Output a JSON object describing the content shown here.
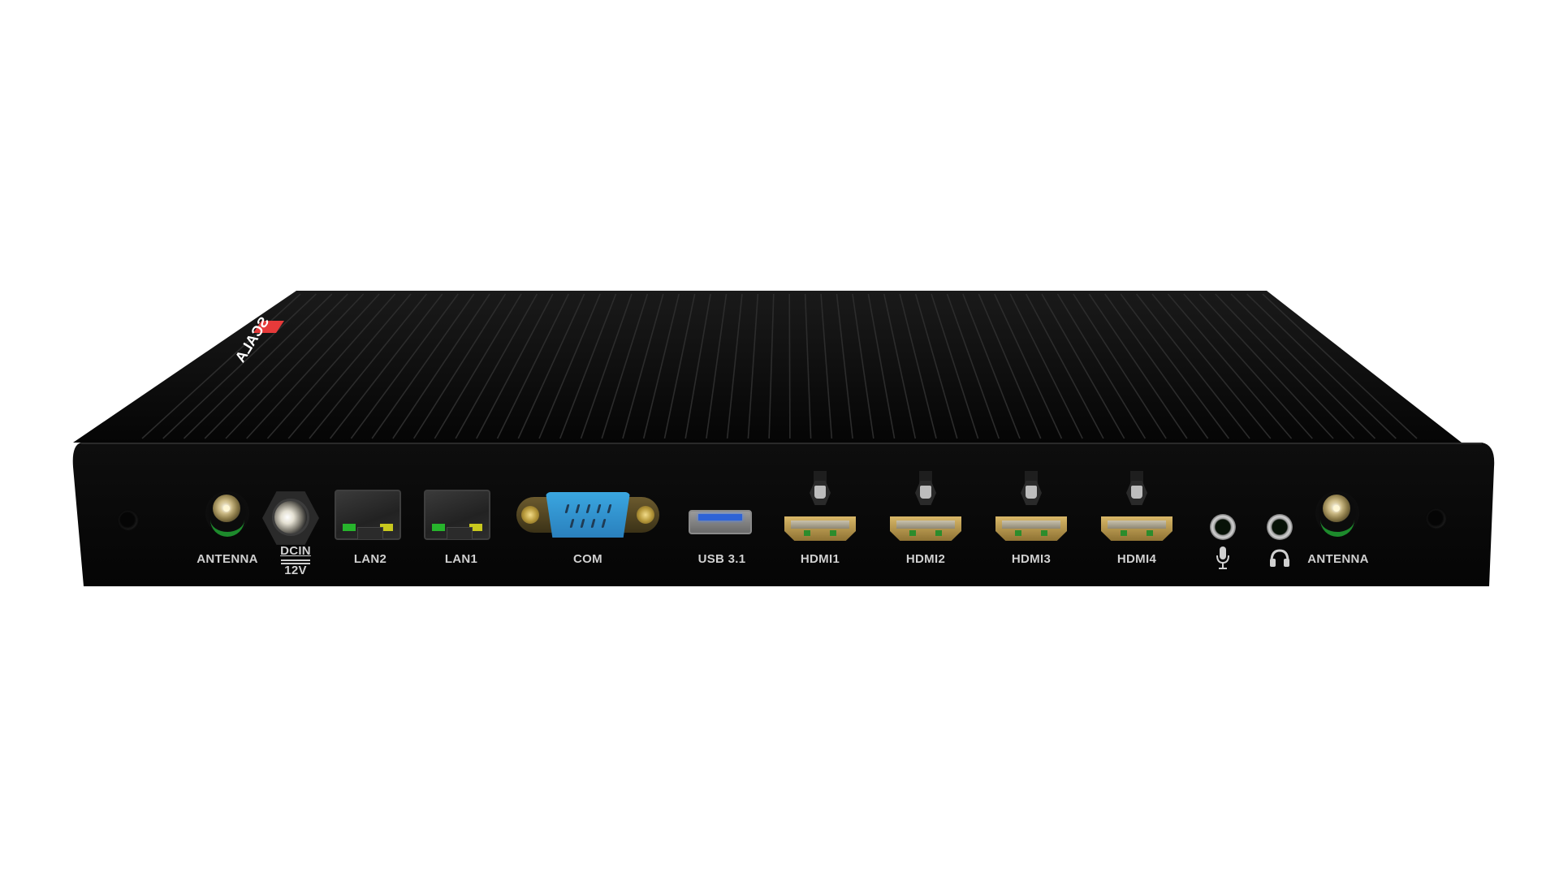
{
  "product": {
    "brand_logo": "SCALA",
    "brand_accent_color": "#e63a3a",
    "body_color": "#0b0b0b",
    "label_color": "#d0d0d0"
  },
  "ports": [
    {
      "id": "antenna-left",
      "type": "antenna",
      "label": "ANTENNA",
      "icon": "sma-antenna-connector-icon"
    },
    {
      "id": "dc-in",
      "type": "dc",
      "label": "DCIN",
      "sublabel": "12V",
      "icon": "dc-power-jack-icon"
    },
    {
      "id": "lan2",
      "type": "lan",
      "label": "LAN2",
      "icon": "rj45-port-icon",
      "led_left_color": "#27b42c",
      "led_right_color": "#c8c81e"
    },
    {
      "id": "lan1",
      "type": "lan",
      "label": "LAN1",
      "icon": "rj45-port-icon",
      "led_left_color": "#27b42c",
      "led_right_color": "#c8c81e"
    },
    {
      "id": "com",
      "type": "serial",
      "label": "COM",
      "icon": "db9-serial-port-icon"
    },
    {
      "id": "usb",
      "type": "usb",
      "label": "USB 3.1",
      "icon": "usb-port-icon"
    },
    {
      "id": "hdmi1",
      "type": "hdmi",
      "label": "HDMI1",
      "icon": "hdmi-port-icon"
    },
    {
      "id": "hdmi2",
      "type": "hdmi",
      "label": "HDMI2",
      "icon": "hdmi-port-icon"
    },
    {
      "id": "hdmi3",
      "type": "hdmi",
      "label": "HDMI3",
      "icon": "hdmi-port-icon"
    },
    {
      "id": "hdmi4",
      "type": "hdmi",
      "label": "HDMI4",
      "icon": "hdmi-port-icon"
    },
    {
      "id": "mic",
      "type": "audio",
      "label": "",
      "icon": "microphone-icon"
    },
    {
      "id": "headphone",
      "type": "audio",
      "label": "",
      "icon": "headphones-icon"
    },
    {
      "id": "antenna-right",
      "type": "antenna",
      "label": "ANTENNA",
      "icon": "sma-antenna-connector-icon"
    }
  ]
}
